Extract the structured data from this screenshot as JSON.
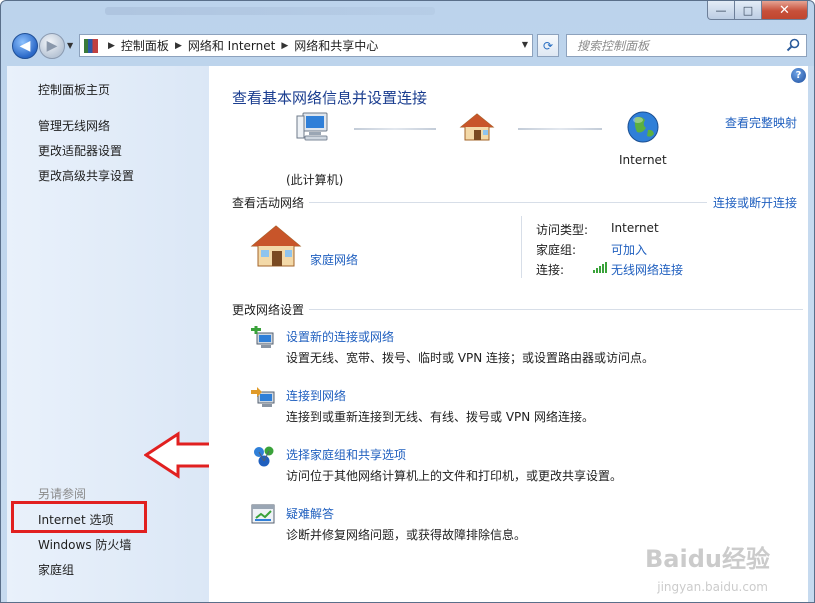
{
  "window": {
    "minimize_label": "—",
    "maximize_label": "□",
    "close_label": "✕"
  },
  "nav": {
    "breadcrumbs": [
      "控制面板",
      "网络和 Internet",
      "网络和共享中心"
    ],
    "search_placeholder": "搜索控制面板"
  },
  "sidebar": {
    "items": [
      {
        "label": "控制面板主页"
      },
      {
        "label": "管理无线网络"
      },
      {
        "label": "更改适配器设置"
      },
      {
        "label": "更改高级共享设置"
      }
    ],
    "see_also_title": "另请参阅",
    "see_also": [
      {
        "label": "Internet 选项"
      },
      {
        "label": "Windows 防火墙"
      },
      {
        "label": "家庭组"
      }
    ]
  },
  "main": {
    "help_label": "?",
    "heading": "查看基本网络信息并设置连接",
    "view_full_map": "查看完整映射",
    "map": {
      "this_computer": "(此计算机)",
      "internet": "Internet"
    },
    "active_networks": {
      "title": "查看活动网络",
      "connect_disconnect": "连接或断开连接",
      "network_name": "家庭网络",
      "access_type_label": "访问类型:",
      "access_type_value": "Internet",
      "homegroup_label": "家庭组:",
      "homegroup_value": "可加入",
      "connection_label": "连接:",
      "connection_value": "无线网络连接"
    },
    "change_settings": {
      "title": "更改网络设置",
      "tasks": [
        {
          "link": "设置新的连接或网络",
          "desc": "设置无线、宽带、拨号、临时或 VPN 连接；或设置路由器或访问点。"
        },
        {
          "link": "连接到网络",
          "desc": "连接到或重新连接到无线、有线、拨号或 VPN 网络连接。"
        },
        {
          "link": "选择家庭组和共享选项",
          "desc": "访问位于其他网络计算机上的文件和打印机，或更改共享设置。"
        },
        {
          "link": "疑难解答",
          "desc": "诊断并修复网络问题，或获得故障排除信息。"
        }
      ]
    }
  },
  "watermark": {
    "brand": "Baidu经验",
    "url": "jingyan.baidu.com"
  },
  "colors": {
    "link_blue": "#1f5fbf",
    "heading_blue": "#1a3d8f",
    "highlight_red": "#e12020"
  }
}
